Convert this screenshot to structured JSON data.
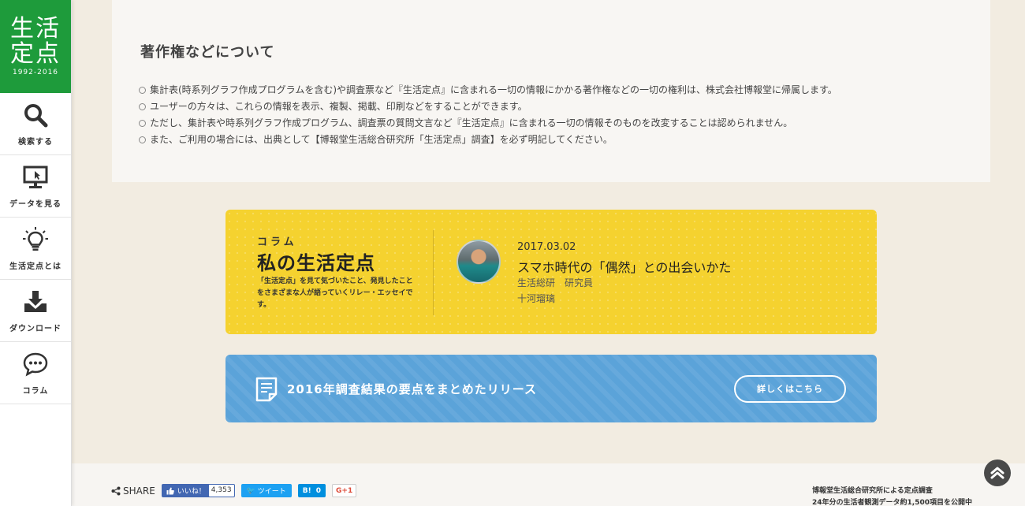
{
  "logo": {
    "line1": "生活",
    "line2": "定点",
    "years": "1992-2016"
  },
  "sidebar": {
    "items": [
      {
        "label": "検索する",
        "icon": "search-icon"
      },
      {
        "label": "データを見る",
        "icon": "monitor-icon"
      },
      {
        "label": "生活定点とは",
        "icon": "lightbulb-icon"
      },
      {
        "label": "ダウンロード",
        "icon": "download-icon"
      },
      {
        "label": "コラム",
        "icon": "chat-bubble-icon"
      }
    ]
  },
  "copyright": {
    "title": "著作権などについて",
    "items": [
      "集計表(時系列グラフ作成プログラムを含む)や調査票など『生活定点』に含まれる一切の情報にかかる著作権などの一切の権利は、株式会社博報堂に帰属します。",
      "ユーザーの方々は、これらの情報を表示、複製、掲載、印刷などをすることができます。",
      "ただし、集計表や時系列グラフ作成プログラム、調査票の質問文言など『生活定点』に含まれる一切の情報そのものを改変することは認められません。",
      "また、ご利用の場合には、出典として【博報堂生活総合研究所「生活定点」調査】を必ず明記してください。"
    ]
  },
  "column": {
    "kicker": "コラム",
    "title": "私の生活定点",
    "description": "「生活定点」を見て気づいたこと、発見したことをさまざまな人が語っていくリレー・エッセイです。",
    "date": "2017.03.02",
    "article_title": "スマホ時代の「偶然」との出会いかた",
    "author_org": "生活総研　研究員",
    "author_name": "十河瑠璃",
    "bg_color": "#f5d22f"
  },
  "release": {
    "text": "2016年調査結果の要点をまとめたリリース",
    "button_label": "詳しくはこちら",
    "bg_color": "#5ba3d9"
  },
  "footer": {
    "share_label": "SHARE",
    "fb_like": "いいね！",
    "fb_count": "4,353",
    "tweet": "ツイート",
    "hatena": "B!",
    "hatena_count": "0",
    "gplus": "G+1",
    "info_line1": "博報堂生活総合研究所による定点調査",
    "info_line2": "24年分の生活者観測データ約1,500項目を公開中"
  },
  "colors": {
    "logo_green": "#1e9b3b",
    "page_bg": "#f2ece1"
  }
}
